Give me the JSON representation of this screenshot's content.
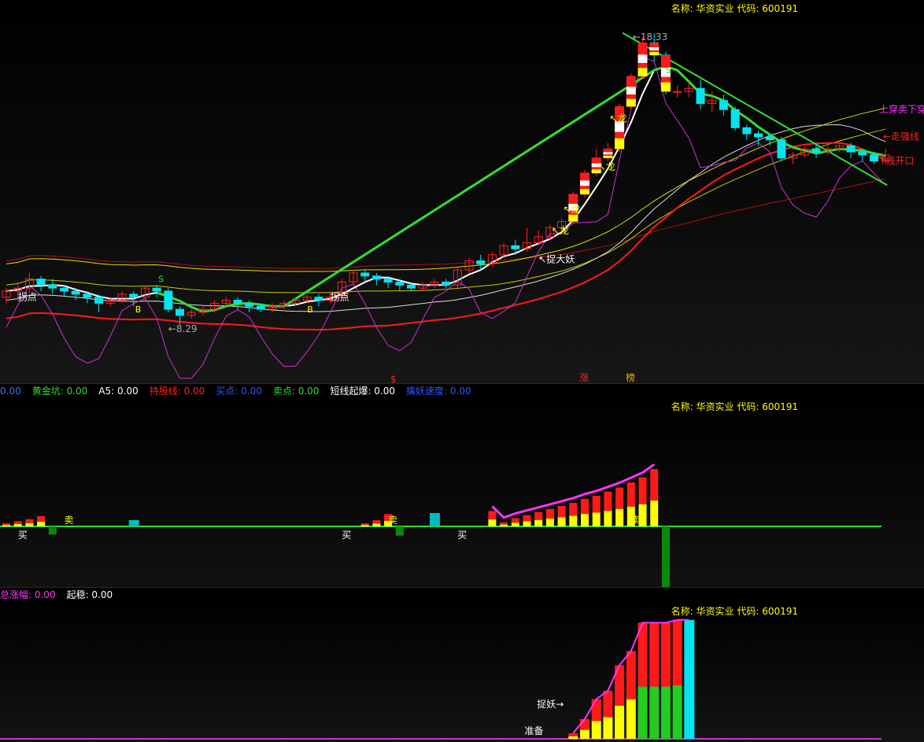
{
  "header": {
    "name_label": "名称:",
    "name": "华资实业",
    "code_label": "代码:",
    "code": "600191"
  },
  "pane1_legend": [
    {
      "label": "",
      "value": "0.00",
      "color": "#3d6dff"
    },
    {
      "label": "黄金坑:",
      "value": "0.00",
      "color": "#33dd33"
    },
    {
      "label": "A5:",
      "value": "0.00",
      "color": "#ffffff"
    },
    {
      "label": "持股线:",
      "value": "0.00",
      "color": "#ff2222"
    },
    {
      "label": "买点:",
      "value": "0.00",
      "color": "#3355ff"
    },
    {
      "label": "卖点:",
      "value": "0.00",
      "color": "#33dd33"
    },
    {
      "label": "短线起爆:",
      "value": "0.00",
      "color": "#ffffff"
    },
    {
      "label": "擒妖速度:",
      "value": "0.00",
      "color": "#3355ff"
    }
  ],
  "pane3_legend": [
    {
      "label": "总涨幅:",
      "value": "0.00",
      "color": "#ff33ff"
    },
    {
      "label": "起稳:",
      "value": "0.00",
      "color": "#ffffff"
    }
  ],
  "pane1_labels": {
    "high_price": "18.33",
    "low_price": "8.29",
    "guaidian": "拐点",
    "long": "龙",
    "capture": "捉大妖",
    "buy_b": "B",
    "sell_s": "S",
    "zhang": "涨",
    "bang": "榜",
    "s_mark": "$",
    "break_down": "上穿卖下穿",
    "strong_line": "←走强线",
    "open_line": "T线开口"
  },
  "pane2_labels": {
    "buy": "买",
    "sell": "卖"
  },
  "pane3_labels": {
    "capture": "捉妖→",
    "prepare": "准备"
  },
  "colors": {
    "candle_up": "#ff2222",
    "candle_down": "#00e5ee",
    "white_line": "#ffffff",
    "yellow_line": "#e0e000",
    "red_line": "#ff1a1a",
    "magenta_line": "#cc33cc",
    "green_line": "#33dd33"
  },
  "chart_data": {
    "type": "candlestick",
    "title": "",
    "price_range": [
      8.29,
      18.33
    ],
    "candles": [
      [
        9.6,
        9.8,
        9.4,
        9.9
      ],
      [
        9.8,
        9.9,
        9.5,
        10.1
      ],
      [
        9.9,
        10.2,
        9.7,
        10.4
      ],
      [
        10.2,
        10.0,
        9.8,
        10.3
      ],
      [
        10.0,
        9.9,
        9.7,
        10.2
      ],
      [
        9.9,
        9.8,
        9.6,
        10.0
      ],
      [
        9.8,
        9.7,
        9.5,
        9.9
      ],
      [
        9.7,
        9.6,
        9.4,
        9.8
      ],
      [
        9.6,
        9.4,
        9.1,
        9.7
      ],
      [
        9.4,
        9.5,
        9.3,
        9.6
      ],
      [
        9.5,
        9.7,
        9.4,
        9.8
      ],
      [
        9.7,
        9.6,
        9.3,
        9.8
      ],
      [
        9.6,
        9.9,
        9.5,
        10.0
      ],
      [
        9.9,
        9.8,
        9.6,
        10.0
      ],
      [
        9.8,
        9.2,
        9.1,
        9.9
      ],
      [
        9.2,
        9.0,
        8.7,
        9.3
      ],
      [
        9.0,
        9.1,
        8.9,
        9.2
      ],
      [
        9.1,
        9.2,
        9.0,
        9.3
      ],
      [
        9.2,
        9.4,
        9.1,
        9.5
      ],
      [
        9.4,
        9.5,
        9.3,
        9.6
      ],
      [
        9.5,
        9.4,
        9.2,
        9.6
      ],
      [
        9.4,
        9.3,
        9.1,
        9.5
      ],
      [
        9.3,
        9.2,
        9.1,
        9.4
      ],
      [
        9.2,
        9.3,
        9.1,
        9.4
      ],
      [
        9.3,
        9.4,
        9.2,
        9.5
      ],
      [
        9.4,
        9.5,
        9.3,
        9.6
      ],
      [
        9.5,
        9.6,
        9.4,
        9.7
      ],
      [
        9.6,
        9.5,
        9.3,
        9.7
      ],
      [
        9.5,
        9.6,
        9.4,
        9.8
      ],
      [
        9.6,
        10.1,
        9.5,
        10.2
      ],
      [
        10.1,
        10.4,
        10.0,
        10.5
      ],
      [
        10.4,
        10.3,
        10.1,
        10.5
      ],
      [
        10.3,
        10.2,
        10.0,
        10.4
      ],
      [
        10.2,
        10.1,
        9.9,
        10.3
      ],
      [
        10.1,
        10.0,
        9.8,
        10.2
      ],
      [
        10.0,
        9.9,
        9.8,
        10.1
      ],
      [
        9.9,
        10.0,
        9.8,
        10.1
      ],
      [
        10.0,
        10.1,
        9.9,
        10.2
      ],
      [
        10.1,
        10.0,
        9.9,
        10.2
      ],
      [
        10.0,
        10.5,
        9.9,
        10.6
      ],
      [
        10.5,
        10.8,
        10.4,
        10.9
      ],
      [
        10.8,
        10.7,
        10.5,
        11.0
      ],
      [
        10.7,
        11.0,
        10.6,
        11.1
      ],
      [
        11.0,
        11.3,
        10.9,
        11.4
      ],
      [
        11.3,
        11.2,
        11.0,
        11.5
      ],
      [
        11.2,
        11.4,
        11.1,
        11.9
      ],
      [
        11.4,
        11.6,
        11.3,
        11.8
      ],
      [
        11.6,
        11.9,
        11.5,
        12.0
      ],
      [
        11.9,
        12.1,
        11.8,
        12.2
      ],
      [
        12.1,
        13.0,
        12.0,
        13.1
      ],
      [
        13.0,
        13.7,
        12.9,
        13.8
      ],
      [
        13.7,
        14.2,
        13.6,
        14.5
      ],
      [
        14.2,
        14.5,
        14.1,
        14.7
      ],
      [
        14.5,
        15.9,
        14.4,
        16.0
      ],
      [
        15.9,
        16.9,
        15.8,
        17.0
      ],
      [
        16.9,
        18.0,
        16.8,
        18.2
      ],
      [
        18.0,
        17.6,
        17.4,
        18.33
      ],
      [
        17.6,
        16.4,
        16.3,
        17.7
      ],
      [
        16.4,
        16.4,
        16.2,
        16.6
      ],
      [
        16.4,
        16.5,
        16.2,
        16.7
      ],
      [
        16.5,
        16.0,
        15.8,
        16.8
      ],
      [
        16.0,
        16.1,
        15.7,
        16.4
      ],
      [
        16.1,
        15.8,
        15.6,
        16.3
      ],
      [
        15.8,
        15.2,
        15.1,
        15.9
      ],
      [
        15.2,
        15.0,
        14.8,
        15.3
      ],
      [
        15.0,
        14.9,
        14.6,
        15.1
      ],
      [
        14.9,
        14.8,
        14.6,
        15.0
      ],
      [
        14.8,
        14.2,
        14.1,
        14.9
      ],
      [
        14.2,
        14.3,
        14.0,
        14.4
      ],
      [
        14.3,
        14.5,
        14.2,
        14.6
      ],
      [
        14.5,
        14.4,
        14.2,
        14.7
      ],
      [
        14.4,
        14.5,
        14.3,
        14.6
      ],
      [
        14.5,
        14.6,
        14.4,
        14.7
      ],
      [
        14.6,
        14.4,
        14.2,
        14.7
      ],
      [
        14.4,
        14.3,
        14.1,
        14.5
      ],
      [
        14.3,
        14.1,
        14.0,
        14.4
      ],
      [
        14.1,
        14.3,
        14.0,
        14.5
      ]
    ],
    "pane2_bars": [
      0.3,
      0.5,
      0.7,
      1.0,
      -0.8,
      0,
      0,
      0,
      0,
      0,
      0,
      0,
      0,
      0,
      0,
      0,
      0,
      0,
      0,
      0,
      0,
      0,
      0,
      0,
      0,
      0,
      0,
      0,
      0,
      0,
      0,
      0.3,
      0.6,
      1.2,
      -0.9,
      0,
      0,
      0,
      0,
      0,
      0,
      0,
      1.5,
      0.4,
      0.8,
      1.1,
      1.4,
      1.7,
      2.0,
      2.3,
      2.7,
      3.0,
      3.4,
      3.8,
      4.3,
      4.8,
      5.6,
      -7.5,
      0,
      0,
      0,
      0,
      0,
      0,
      0,
      0,
      0,
      0,
      0,
      0,
      0,
      0,
      0,
      0,
      0,
      0,
      0
    ],
    "pane3_bars": [
      0,
      0,
      0,
      0,
      0,
      0,
      0,
      0,
      0,
      0,
      0,
      0,
      0,
      0,
      0,
      0,
      0,
      0,
      0,
      0,
      0,
      0,
      0,
      0,
      0,
      0,
      0,
      0,
      0,
      0,
      0,
      0,
      0,
      0,
      0,
      0,
      0,
      0,
      0,
      0,
      0,
      0,
      0,
      0,
      0,
      0,
      0,
      0,
      0,
      0.2,
      0.7,
      1.4,
      1.7,
      2.6,
      3.1,
      4.1,
      4.1,
      4.1,
      4.2,
      4.2,
      0,
      0,
      0,
      0,
      0,
      0,
      0,
      0,
      0,
      0,
      0,
      0,
      0,
      0,
      0,
      0,
      0
    ]
  }
}
